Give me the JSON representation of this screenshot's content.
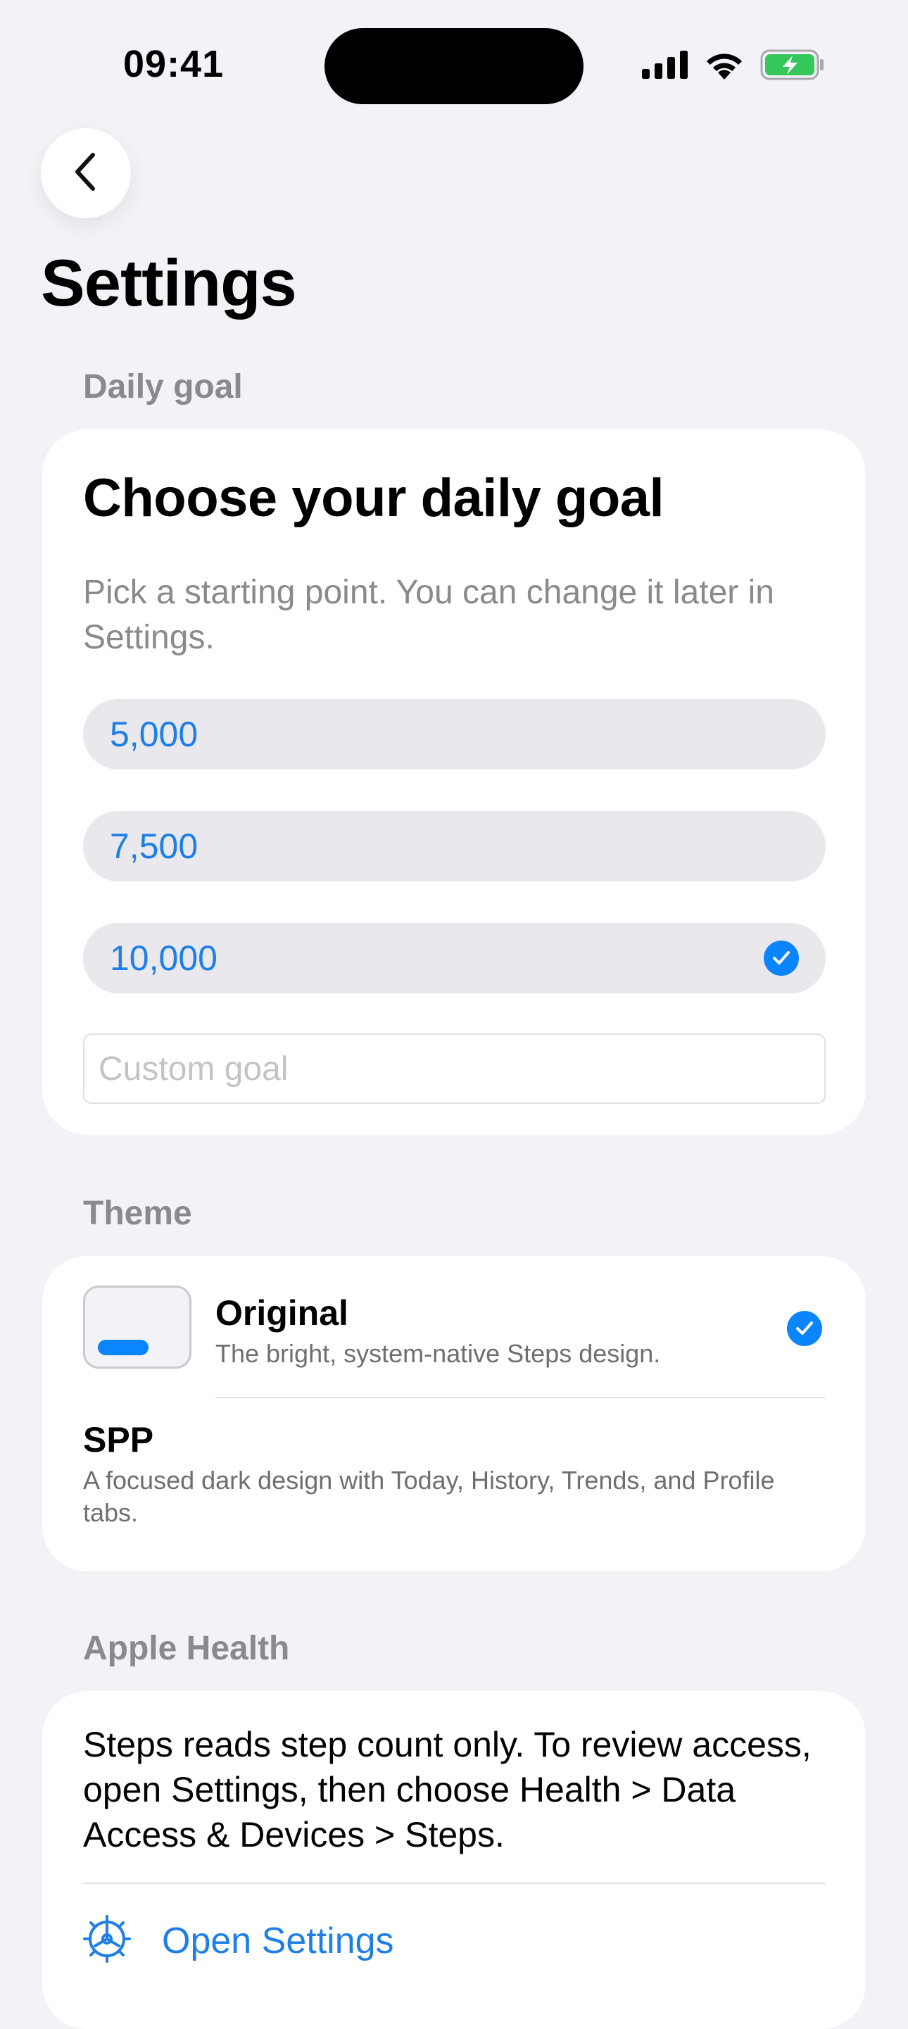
{
  "status_bar": {
    "time": "09:41"
  },
  "page": {
    "title": "Settings"
  },
  "daily_goal": {
    "section_label": "Daily goal",
    "heading": "Choose your daily goal",
    "description": "Pick a starting point. You can change it later in Settings.",
    "options": [
      {
        "label": "5,000",
        "selected": false
      },
      {
        "label": "7,500",
        "selected": false
      },
      {
        "label": "10,000",
        "selected": true
      }
    ],
    "custom_placeholder": "Custom goal",
    "custom_value": ""
  },
  "theme": {
    "section_label": "Theme",
    "options": [
      {
        "name": "Original",
        "description": "The bright, system-native Steps design.",
        "selected": true
      },
      {
        "name": "SPP",
        "description": "A focused dark design with Today, History, Trends, and Profile tabs.",
        "selected": false
      }
    ]
  },
  "apple_health": {
    "section_label": "Apple Health",
    "body": "Steps reads step count only. To review access, open Settings, then choose Health > Data Access & Devices > Steps.",
    "open_settings_label": "Open Settings"
  },
  "colors": {
    "background": "#f2f2f7",
    "accent": "#0a84ff",
    "link_text": "#1f7fe6",
    "secondary_text": "#8a8a8e",
    "battery_green": "#34c759"
  }
}
